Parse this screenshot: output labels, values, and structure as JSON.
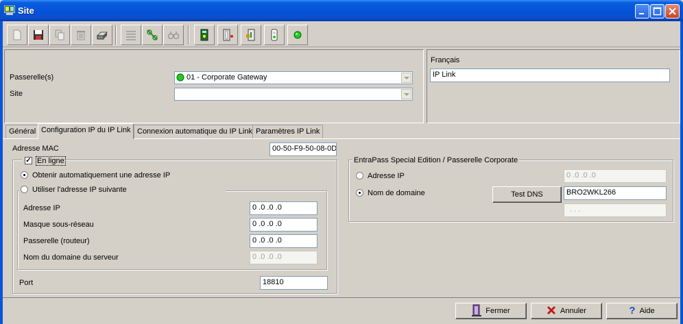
{
  "window": {
    "title": "Site"
  },
  "toolbar": {
    "icons": [
      "new-icon",
      "save-icon",
      "copy-icon",
      "delete-icon",
      "print-icon",
      "list-icon",
      "link-icon",
      "find-icon",
      "gateway-icon",
      "door-icon",
      "door-lock-icon",
      "traffic-light-icon",
      "status-green-icon"
    ]
  },
  "header": {
    "gateway_label": "Passerelle(s)",
    "gateway_value": "01 - Corporate Gateway",
    "site_label": "Site",
    "site_value": "",
    "language_label": "Français",
    "language_value": "IP Link"
  },
  "tabs": [
    {
      "label": "Général"
    },
    {
      "label": "Configuration IP du IP Link"
    },
    {
      "label": "Connexion automatique du IP Link"
    },
    {
      "label": "Paramètres IP Link"
    }
  ],
  "ipconfig": {
    "mac_label": "Adresse MAC",
    "mac_value": "00-50-F9-50-08-0D",
    "online_label": "En ligne",
    "online_checked": true,
    "auto_ip_label": "Obtenir automatiquement une adresse IP",
    "manual_ip_label": "Utiliser l'adresse IP suivante",
    "ip_label": "Adresse IP",
    "ip_value": "0 .0 .0 .0",
    "mask_label": "Masque sous-réseau",
    "mask_value": "0 .0 .0 .0",
    "gateway_label": "Passerelle (routeur)",
    "gateway_value": "0 .0 .0 .0",
    "dns_label": "Nom du domaine du serveur",
    "dns_value": "0 .0 .0 .0",
    "port_label": "Port",
    "port_value": "18810"
  },
  "entrapass": {
    "legend": "EntraPass Special Edition / Passerelle Corporate",
    "ip_label": "Adresse IP",
    "ip_value": "0 .0 .0 .0",
    "domain_label": "Nom de domaine",
    "test_dns_label": "Test DNS",
    "domain_value": "BRO2WKL266",
    "resolved_value": ". . ."
  },
  "buttons": {
    "close_label": "Fermer",
    "cancel_label": "Annuler",
    "help_label": "Aide"
  }
}
